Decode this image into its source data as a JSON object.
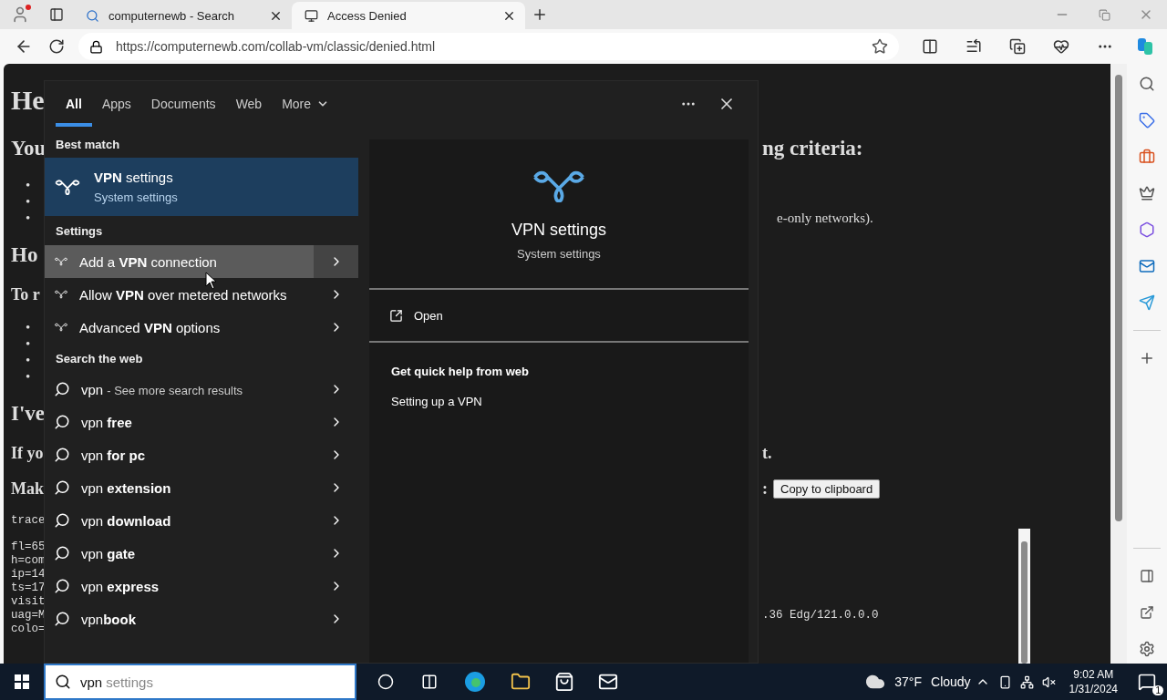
{
  "browser": {
    "tabs": [
      {
        "title": "computernewb - Search",
        "selected": false
      },
      {
        "title": "Access Denied",
        "selected": true
      }
    ],
    "url": "https://computernewb.com/collab-vm/classic/denied.html"
  },
  "page": {
    "lines": [
      {
        "kind": "h1",
        "left": "He"
      },
      {
        "kind": "h2",
        "left": "You",
        "right": "ng criteria:"
      },
      {
        "kind": "bullet",
        "left": "•"
      },
      {
        "kind": "bullet",
        "left": "•"
      },
      {
        "kind": "bullet",
        "left": "•",
        "right": "e-only networks)."
      },
      {
        "kind": "h2",
        "left": "Ho"
      },
      {
        "kind": "h3",
        "left": "To r"
      },
      {
        "kind": "bullet",
        "left": "•"
      },
      {
        "kind": "bullet",
        "left": "•"
      },
      {
        "kind": "bullet",
        "left": "•"
      },
      {
        "kind": "bullet",
        "left": "•"
      },
      {
        "kind": "h2",
        "left": "I've"
      },
      {
        "kind": "h3",
        "left": "If yo",
        "right": "t."
      },
      {
        "kind": "h3",
        "left": "Mak",
        "right": ":",
        "button": "Copy to clipboard"
      },
      {
        "kind": "codehead",
        "left": "trace"
      },
      {
        "kind": "code",
        "left": "fl=65"
      },
      {
        "kind": "code",
        "left": "h=com"
      },
      {
        "kind": "code",
        "left": "ip=14"
      },
      {
        "kind": "code",
        "left": "ts=17"
      },
      {
        "kind": "code",
        "left": "visit"
      },
      {
        "kind": "code",
        "left": "uag=M",
        "right": ".36 Edg/121.0.0.0"
      },
      {
        "kind": "code",
        "left": "colo="
      }
    ]
  },
  "search": {
    "tabs": [
      {
        "label": "All",
        "selected": true,
        "dropdown": false
      },
      {
        "label": "Apps",
        "selected": false,
        "dropdown": false
      },
      {
        "label": "Documents",
        "selected": false,
        "dropdown": false
      },
      {
        "label": "Web",
        "selected": false,
        "dropdown": false
      },
      {
        "label": "More",
        "selected": false,
        "dropdown": true
      }
    ],
    "best_match": {
      "heading": "Best match",
      "title": "**VPN** settings",
      "subtitle": "System settings",
      "selected": true
    },
    "settings": {
      "heading": "Settings",
      "items": [
        {
          "text": "Add a **VPN** connection",
          "hovered": true
        },
        {
          "text": "Allow **VPN** over metered networks",
          "hovered": false
        },
        {
          "text": "Advanced **VPN** options",
          "hovered": false
        }
      ]
    },
    "web": {
      "heading": "Search the web",
      "items": [
        {
          "text": "vpn",
          "note": "- See more search results",
          "hovered": false
        },
        {
          "text": "vpn **free**",
          "hovered": false
        },
        {
          "text": "vpn **for pc**",
          "hovered": false
        },
        {
          "text": "vpn **extension**",
          "hovered": false
        },
        {
          "text": "vpn **download**",
          "hovered": false
        },
        {
          "text": "vpn **gate**",
          "hovered": false
        },
        {
          "text": "vpn **express**",
          "hovered": false
        },
        {
          "text": "vpn**book**",
          "hovered": false
        }
      ]
    },
    "preview": {
      "title": "VPN settings",
      "subtitle": "System settings",
      "action": "Open",
      "help_heading": "Get quick help from web",
      "links": [
        "Setting up a VPN"
      ]
    }
  },
  "taskbar": {
    "search": {
      "value": "vpn",
      "suggestion": "settings"
    },
    "weather": {
      "temperature": "37°F",
      "condition": "Cloudy"
    },
    "time": "9:02 AM",
    "date": "1/31/2024",
    "notifications": "1"
  }
}
